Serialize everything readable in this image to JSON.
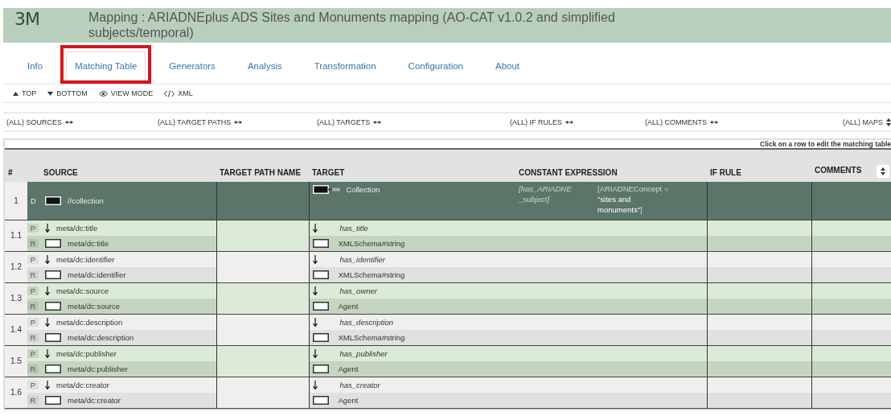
{
  "header": {
    "logo": "3M",
    "title": "Mapping : ARIADNEplus ADS Sites and Monuments mapping (AO-CAT v1.0.2 and simplified subjects/temporal)"
  },
  "tabs": [
    {
      "label": "Info",
      "selected": false
    },
    {
      "label": "Matching Table",
      "selected": true,
      "highlighted": true
    },
    {
      "label": "Generators",
      "selected": false
    },
    {
      "label": "Analysis",
      "selected": false
    },
    {
      "label": "Transformation",
      "selected": false
    },
    {
      "label": "Configuration",
      "selected": false
    },
    {
      "label": "About",
      "selected": false
    }
  ],
  "toolbar": [
    {
      "kind": "up",
      "label": "TOP"
    },
    {
      "kind": "down",
      "label": "BOTTOM"
    },
    {
      "kind": "eye",
      "label": "VIEW MODE"
    },
    {
      "kind": "code",
      "label": "XML"
    }
  ],
  "filters": [
    {
      "label": "(ALL) SOURCES",
      "kind": "expand"
    },
    {
      "label": "(ALL) TARGET PATHS",
      "kind": "expand"
    },
    {
      "label": "(ALL) TARGETS",
      "kind": "expand"
    },
    {
      "label": "(ALL) IF RULES",
      "kind": "expand"
    },
    {
      "label": "(ALL) COMMENTS",
      "kind": "expand"
    },
    {
      "label": "(ALL) MAPS",
      "kind": "sort"
    }
  ],
  "hint": "Click on a row to edit the matching table",
  "table": {
    "columns": [
      "#",
      "SOURCE",
      "TARGET PATH NAME",
      "TARGET",
      "CONSTANT EXPRESSION",
      "IF RULE",
      "COMMENTS"
    ],
    "domain": {
      "number": "1",
      "type": "D",
      "source": "//collection",
      "target": "Collection",
      "constant_expression": {
        "property": "[has_ARIADNE _subject]",
        "concept": "[ARIADNEConcept =",
        "value": "\"sites and monuments\"",
        "close": "]"
      }
    },
    "groups": [
      {
        "number": "1.1",
        "rows": [
          {
            "type": "P",
            "source": "meta/dc:title",
            "target": "has_title"
          },
          {
            "type": "R",
            "source": "meta/dc:title",
            "target": "XMLSchema#string"
          }
        ]
      },
      {
        "number": "1.2",
        "rows": [
          {
            "type": "P",
            "source": "meta/dc:identifier",
            "target": "has_identifier"
          },
          {
            "type": "R",
            "source": "meta/dc:identifier",
            "target": "XMLSchema#string"
          }
        ]
      },
      {
        "number": "1.3",
        "rows": [
          {
            "type": "P",
            "source": "meta/dc:source",
            "target": "has_owner"
          },
          {
            "type": "R",
            "source": "meta/dc:source",
            "target": "Agent"
          }
        ]
      },
      {
        "number": "1.4",
        "rows": [
          {
            "type": "P",
            "source": "meta/dc:description",
            "target": "has_description"
          },
          {
            "type": "R",
            "source": "meta/dc:description",
            "target": "XMLSchema#string"
          }
        ]
      },
      {
        "number": "1.5",
        "rows": [
          {
            "type": "P",
            "source": "meta/dc:publisher",
            "target": "has_publisher"
          },
          {
            "type": "R",
            "source": "meta/dc:publisher",
            "target": "Agent"
          }
        ]
      },
      {
        "number": "1.6",
        "rows": [
          {
            "type": "P",
            "source": "meta/dc:creator",
            "target": "has_creator"
          },
          {
            "type": "R",
            "source": "meta/dc:creator",
            "target": "Agent"
          }
        ]
      }
    ]
  }
}
